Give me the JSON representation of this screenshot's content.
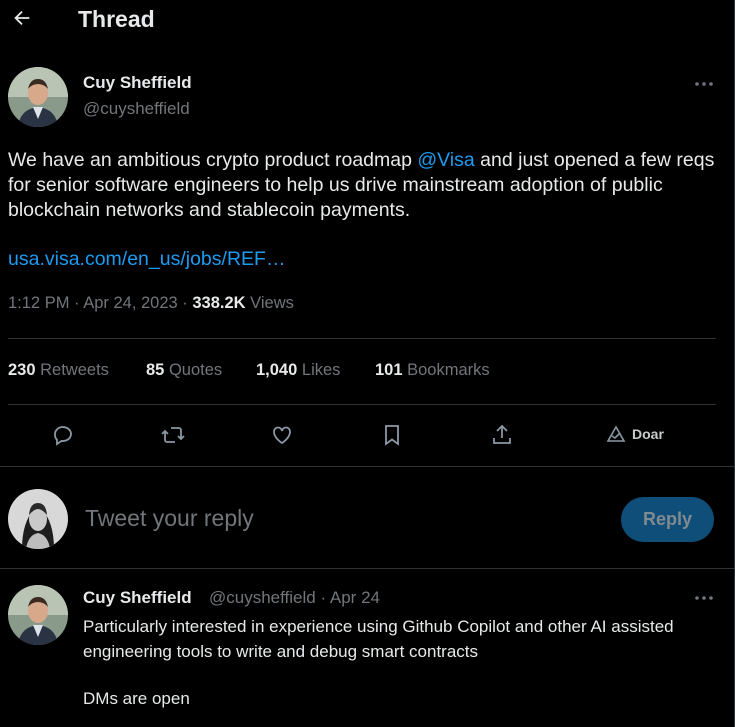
{
  "header": {
    "title": "Thread"
  },
  "tweet": {
    "author_name": "Cuy Sheffield",
    "author_handle": "@cuysheffield",
    "text_part1": "We have an ambitious crypto product roadmap ",
    "mention": "@Visa",
    "text_part2": " and just opened a few reqs for senior software engineers to help us drive mainstream adoption of public blockchain networks and stablecoin payments.",
    "link": "usa.visa.com/en_us/jobs/REF…",
    "time": "1:12 PM · Apr 24, 2023 · ",
    "views_count": "338.2K",
    "views_label": " Views",
    "stats": {
      "retweets": {
        "count": "230",
        "label": "Retweets"
      },
      "quotes": {
        "count": "85",
        "label": "Quotes"
      },
      "likes": {
        "count": "1,040",
        "label": "Likes"
      },
      "bookmarks": {
        "count": "101",
        "label": "Bookmarks"
      }
    },
    "actions": {
      "reply": "reply-icon",
      "retweet": "retweet-icon",
      "like": "heart-icon",
      "bookmark": "bookmark-icon",
      "share": "share-icon",
      "doar_label": "Doar"
    }
  },
  "composer": {
    "placeholder": "Tweet your reply",
    "reply_label": "Reply"
  },
  "reply": {
    "author_name": "Cuy Sheffield",
    "meta": "@cuysheffield · Apr 24",
    "text": "Particularly interested in experience using Github Copilot and other AI assisted engineering tools to write and debug smart contracts",
    "text2": "DMs are open"
  },
  "colors": {
    "accent": "#1d9bf0",
    "muted": "#71767b",
    "text": "#e7e9ea",
    "reply_button": "#0f4e78"
  }
}
